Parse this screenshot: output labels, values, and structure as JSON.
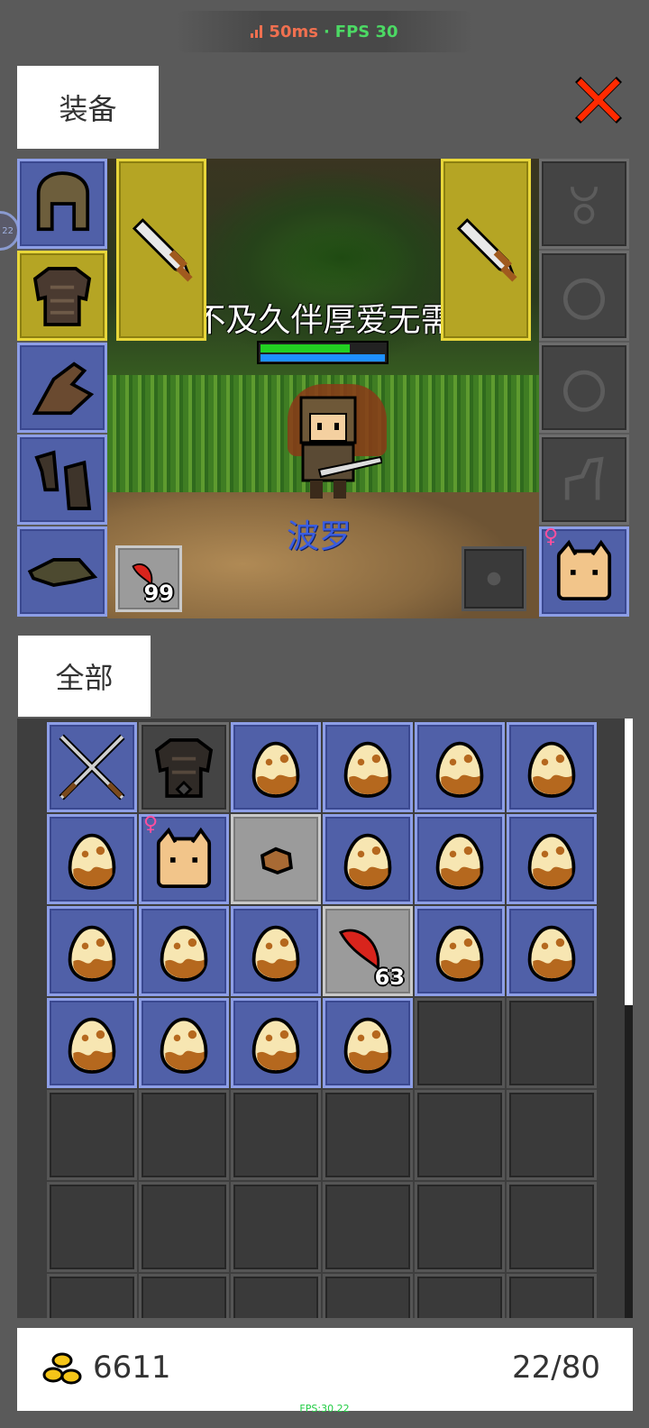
{
  "network": {
    "ping": "50ms",
    "separator": "·",
    "fps": "FPS 30"
  },
  "tabs": {
    "equipment": "装备",
    "all": "全部"
  },
  "side_bubble": "22",
  "scene": {
    "sign_text": "深情不及久伴厚爱无需多言",
    "player_name": "波罗",
    "hp_fraction": 0.72,
    "mp_fraction": 1.0
  },
  "equipment": {
    "left_slots": [
      "helmet-icon",
      "armor-icon",
      "glove-icon",
      "boot-icon",
      "hat-icon"
    ],
    "weapon_left": "sword-icon",
    "weapon_right": "sword-icon",
    "right_slots": [
      "necklace-icon",
      "ring-icon",
      "ring-icon",
      "mount-icon",
      "pet-icon"
    ],
    "consumable": {
      "icon": "red-feather-icon",
      "count": "99"
    }
  },
  "inventory": {
    "items": [
      {
        "icon": "crossed-swords-icon",
        "style": "blue"
      },
      {
        "icon": "armor-icon",
        "style": "gray"
      },
      {
        "icon": "egg-icon",
        "style": "blue"
      },
      {
        "icon": "egg-icon",
        "style": "blue"
      },
      {
        "icon": "egg-icon",
        "style": "blue"
      },
      {
        "icon": "egg-icon",
        "style": "blue"
      },
      {
        "icon": "egg-icon",
        "style": "blue"
      },
      {
        "icon": "pet-icon",
        "style": "blue",
        "female": "♀"
      },
      {
        "icon": "ore-icon",
        "style": "light"
      },
      {
        "icon": "egg-icon",
        "style": "blue"
      },
      {
        "icon": "egg-icon",
        "style": "blue"
      },
      {
        "icon": "egg-icon",
        "style": "blue"
      },
      {
        "icon": "egg-icon",
        "style": "blue"
      },
      {
        "icon": "egg-icon",
        "style": "blue"
      },
      {
        "icon": "egg-icon",
        "style": "blue"
      },
      {
        "icon": "red-feather-icon",
        "style": "light",
        "count": "63"
      },
      {
        "icon": "egg-icon",
        "style": "blue"
      },
      {
        "icon": "egg-icon",
        "style": "blue"
      },
      {
        "icon": "egg-icon",
        "style": "blue"
      },
      {
        "icon": "egg-icon",
        "style": "blue"
      },
      {
        "icon": "egg-icon",
        "style": "blue"
      },
      {
        "icon": "egg-icon",
        "style": "blue"
      }
    ]
  },
  "footer": {
    "gold": "6611",
    "capacity": "22/80"
  },
  "debug": {
    "fps": "FPS:30.22"
  },
  "colors": {
    "slot_blue": "#5060a8",
    "slot_yellow": "#b5a524",
    "ping": "#f07050",
    "fps": "#4cd964"
  }
}
